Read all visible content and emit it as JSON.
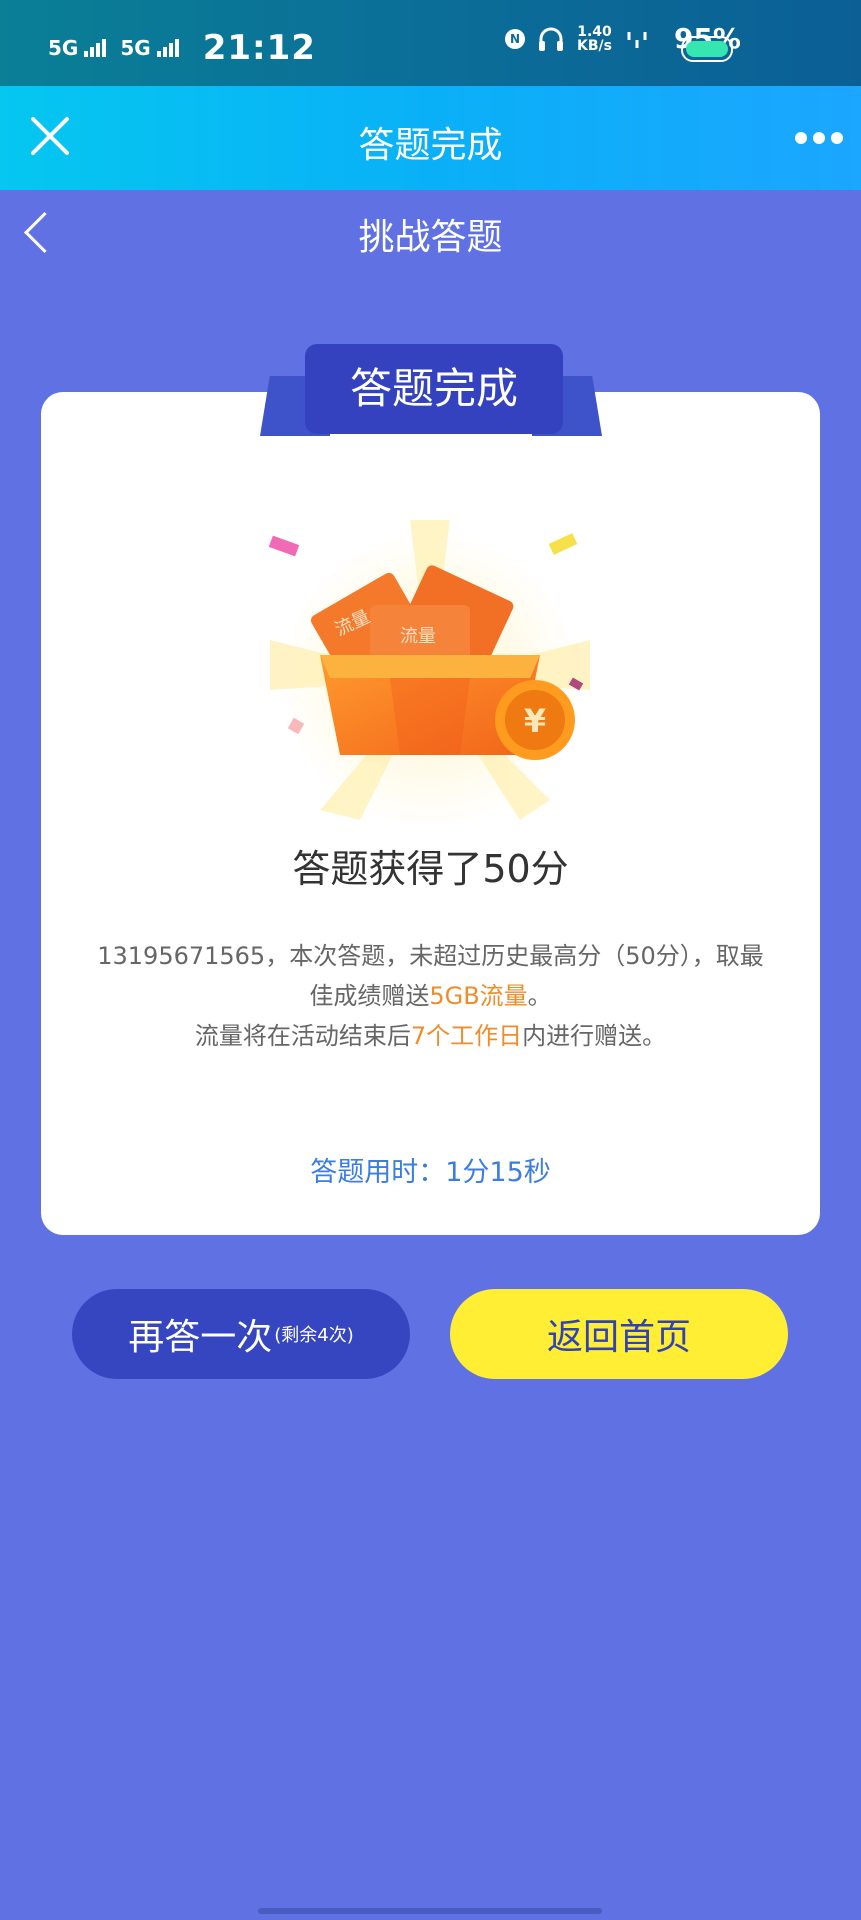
{
  "status_bar": {
    "sim1": "5G",
    "sim2": "5G",
    "time": "21:12",
    "nfc": "N",
    "speed_value": "1.40",
    "speed_unit": "KB/s",
    "battery": "95%"
  },
  "app_header": {
    "title": "答题完成"
  },
  "page": {
    "title": "挑战答题"
  },
  "card": {
    "ribbon": "答题完成",
    "illustration_labels": [
      "流量",
      "流量"
    ],
    "coin_symbol": "¥",
    "score_title": "答题获得了50分",
    "desc_line1": "13195671565，本次答题，未超过历史最高分（50分），取最",
    "desc_line2_a": "佳成绩赠送",
    "desc_line2_hl": "5GB流量",
    "desc_line2_b": "。",
    "desc_line3_a": "流量将在活动结束后",
    "desc_line3_hl": "7个工作日",
    "desc_line3_b": "内进行赠送。",
    "time_used": "答题用时：1分15秒"
  },
  "buttons": {
    "retry_label": "再答一次",
    "retry_note": "(剩余4次)",
    "home_label": "返回首页"
  },
  "colors": {
    "background": "#6072E3",
    "highlight": "#F08C2A",
    "primary_button": "#3546C0",
    "secondary_button": "#FFEE33"
  }
}
